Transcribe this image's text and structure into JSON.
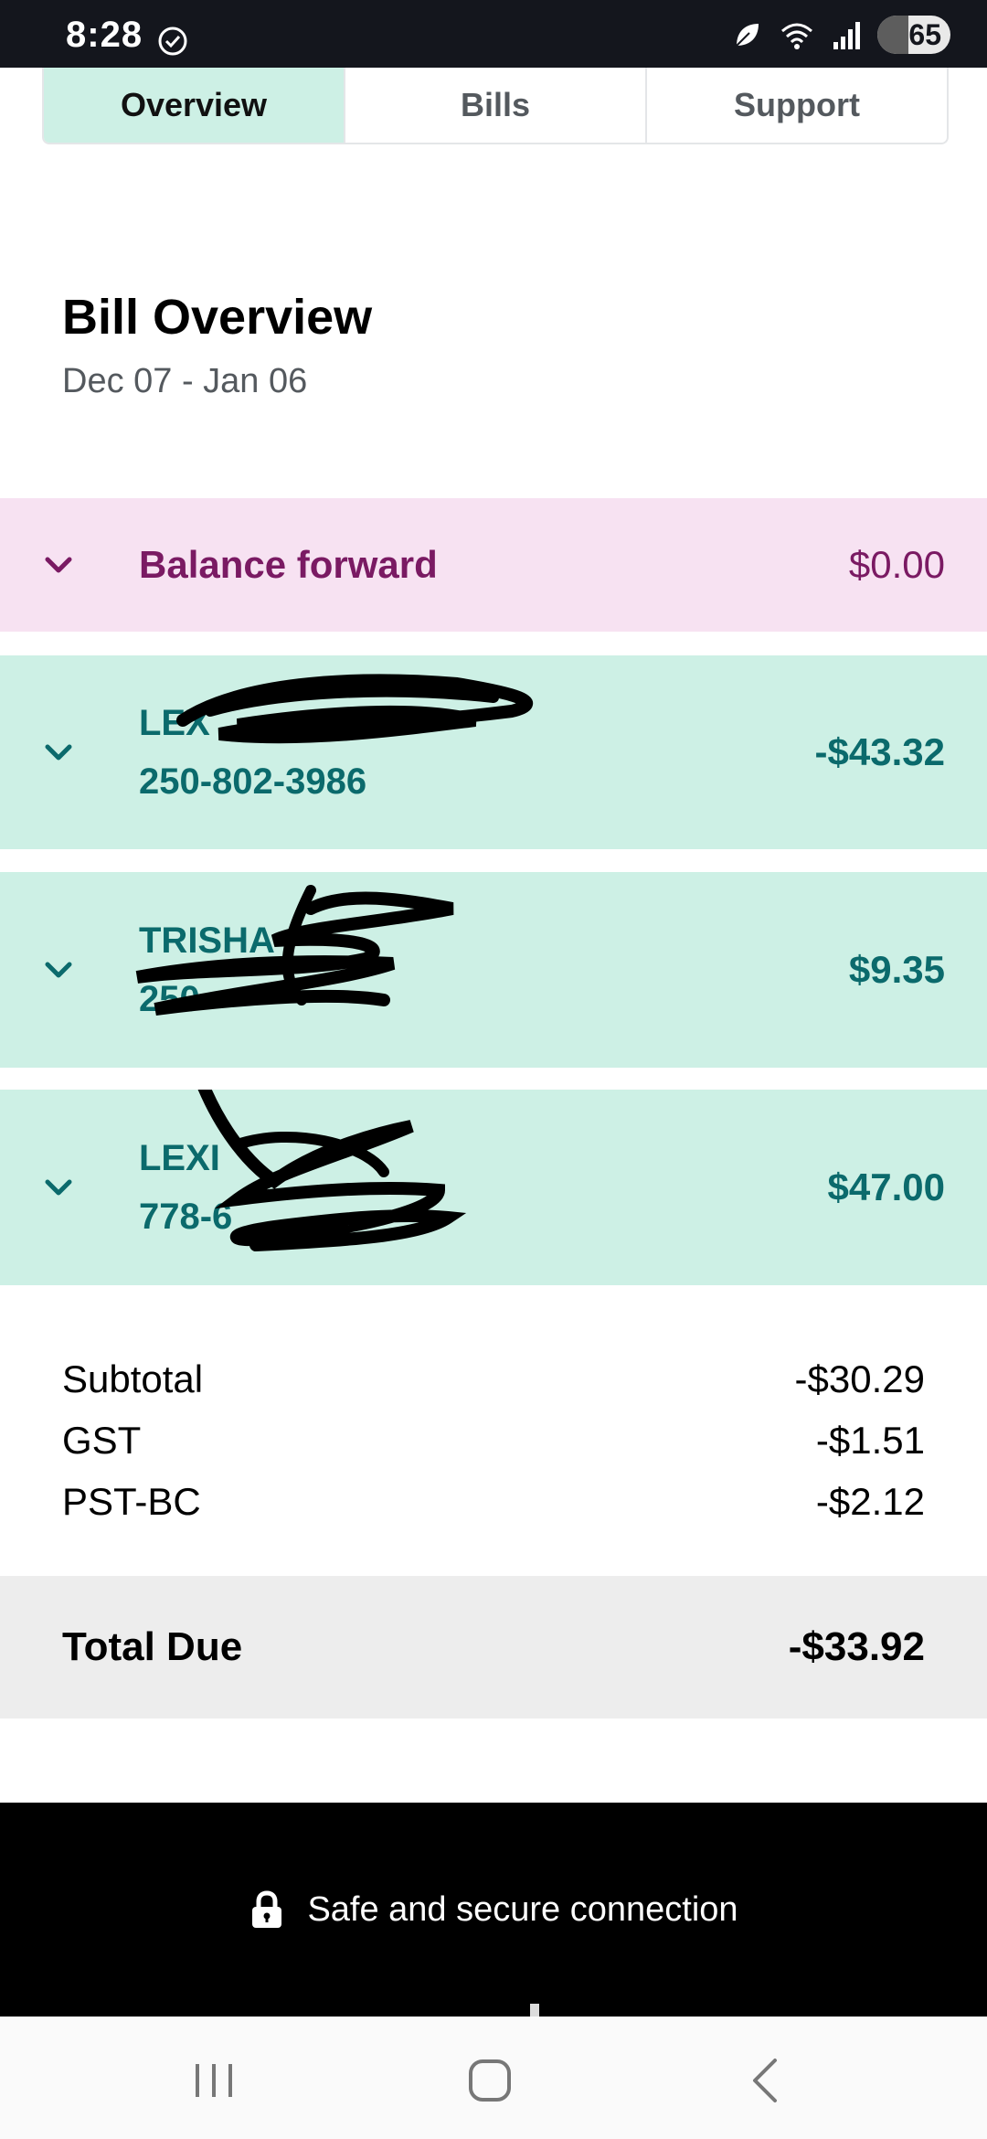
{
  "status_bar": {
    "time": "8:28",
    "battery": "65",
    "icons": [
      "check-circle-icon",
      "leaf-icon",
      "wifi-icon",
      "signal-icon",
      "battery-icon"
    ]
  },
  "tabs": [
    {
      "label": "Overview",
      "active": true
    },
    {
      "label": "Bills",
      "active": false
    },
    {
      "label": "Support",
      "active": false
    }
  ],
  "bill": {
    "title": "Bill Overview",
    "period": "Dec 07 - Jan 06"
  },
  "rows": {
    "balance_forward": {
      "label": "Balance forward",
      "amount": "$0.00"
    },
    "line1": {
      "name": "LEX",
      "number": "250-802-3986",
      "amount": "-$43.32"
    },
    "line2": {
      "name": "TRISHA",
      "number": "250-",
      "amount": "$9.35"
    },
    "line3": {
      "name": "LEXI",
      "number": "778-6",
      "amount": "$47.00"
    }
  },
  "summary": {
    "subtotal_label": "Subtotal",
    "subtotal": "-$30.29",
    "gst_label": "GST",
    "gst": "-$1.51",
    "pst_label": "PST-BC",
    "pst": "-$2.12",
    "total_label": "Total Due",
    "total": "-$33.92"
  },
  "footer": {
    "secure_text": "Safe and secure connection"
  },
  "colors": {
    "tab_active": "#cdf0e5",
    "balance_bg": "#f7e2f2",
    "balance_text": "#7a1a63",
    "line_bg": "#cdf0e5",
    "line_text": "#0b6a6c",
    "total_bg": "#ededed"
  }
}
